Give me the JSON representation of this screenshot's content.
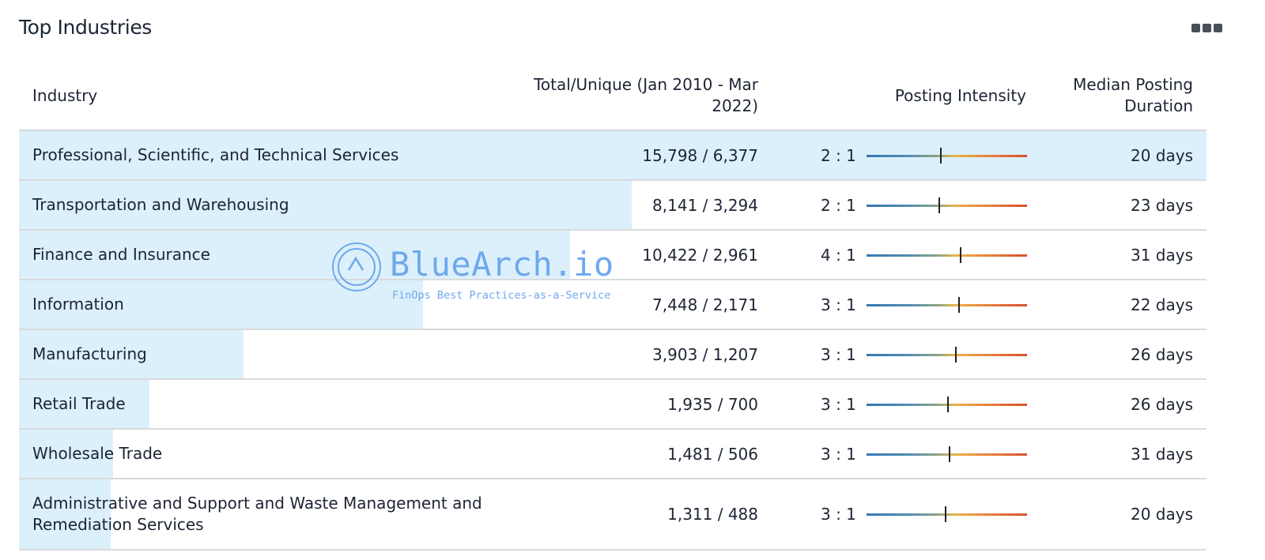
{
  "title": "Top Industries",
  "more_icon": "more-horizontal-icon",
  "columns": {
    "industry": "Industry",
    "total": "Total/Unique (Jan 2010 - Mar 2022)",
    "intensity": "Posting Intensity",
    "median": "Median Posting Duration"
  },
  "rows": [
    {
      "industry": "Professional, Scientific, and Technical Services",
      "total": "15,798 / 6,377",
      "ratio": "2 : 1",
      "marker": 0.46,
      "median": "20 days",
      "bar": 1.0
    },
    {
      "industry": "Transportation and Warehousing",
      "total": "8,141 / 3,294",
      "ratio": "2 : 1",
      "marker": 0.45,
      "median": "23 days",
      "bar": 0.516
    },
    {
      "industry": "Finance and Insurance",
      "total": "10,422 / 2,961",
      "ratio": "4 : 1",
      "marker": 0.58,
      "median": "31 days",
      "bar": 0.464
    },
    {
      "industry": "Information",
      "total": "7,448 / 2,171",
      "ratio": "3 : 1",
      "marker": 0.57,
      "median": "22 days",
      "bar": 0.34
    },
    {
      "industry": "Manufacturing",
      "total": "3,903 / 1,207",
      "ratio": "3 : 1",
      "marker": 0.55,
      "median": "26 days",
      "bar": 0.189
    },
    {
      "industry": "Retail Trade",
      "total": "1,935 / 700",
      "ratio": "3 : 1",
      "marker": 0.5,
      "median": "26 days",
      "bar": 0.11
    },
    {
      "industry": "Wholesale Trade",
      "total": "1,481 / 506",
      "ratio": "3 : 1",
      "marker": 0.51,
      "median": "31 days",
      "bar": 0.079
    },
    {
      "industry": "Administrative and Support and Waste Management and Remediation Services",
      "total": "1,311 / 488",
      "ratio": "3 : 1",
      "marker": 0.49,
      "median": "20 days",
      "bar": 0.077
    }
  ],
  "watermark": {
    "name": "BlueArch.io",
    "tagline": "FinOps Best Practices-as-a-Service"
  },
  "colors": {
    "row_bar": "#dcf0fb",
    "watermark": "#6fa8ec"
  }
}
